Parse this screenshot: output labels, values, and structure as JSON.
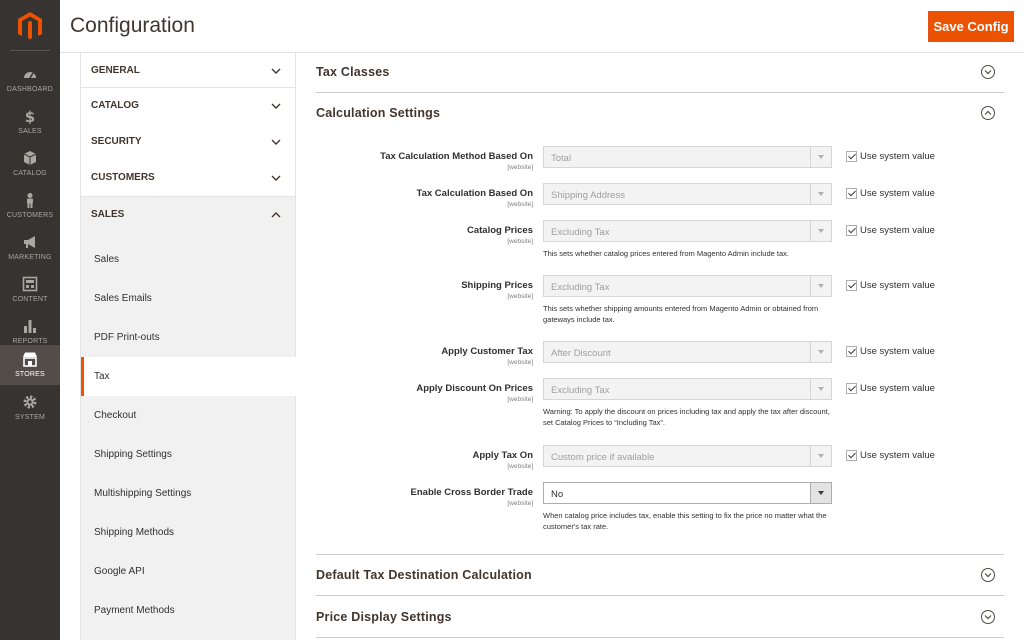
{
  "admin_nav": {
    "items": [
      {
        "label": "DASHBOARD",
        "icon": "dashboard-icon"
      },
      {
        "label": "SALES",
        "icon": "dollar-icon"
      },
      {
        "label": "CATALOG",
        "icon": "cube-icon"
      },
      {
        "label": "CUSTOMERS",
        "icon": "person-icon"
      },
      {
        "label": "MARKETING",
        "icon": "megaphone-icon"
      },
      {
        "label": "CONTENT",
        "icon": "layout-icon"
      },
      {
        "label": "REPORTS",
        "icon": "bar-chart-icon"
      },
      {
        "label": "STORES",
        "icon": "storefront-icon"
      },
      {
        "label": "SYSTEM",
        "icon": "gear-icon"
      }
    ],
    "active": "STORES"
  },
  "header": {
    "title": "Configuration",
    "save_label": "Save Config",
    "accent_color": "#eb5202"
  },
  "sidebar": {
    "tabs": [
      {
        "label": "GENERAL",
        "expanded": false
      },
      {
        "label": "CATALOG",
        "expanded": false
      },
      {
        "label": "SECURITY",
        "expanded": false
      },
      {
        "label": "CUSTOMERS",
        "expanded": false
      },
      {
        "label": "SALES",
        "expanded": true
      }
    ],
    "sales_items": [
      "Sales",
      "Sales Emails",
      "PDF Print-outs",
      "Tax",
      "Checkout",
      "Shipping Settings",
      "Multishipping Settings",
      "Shipping Methods",
      "Google API",
      "Payment Methods"
    ],
    "active_item": "Tax"
  },
  "main": {
    "sections": {
      "tax_classes": "Tax Classes",
      "calculation_settings": "Calculation Settings",
      "default_destination": "Default Tax Destination Calculation",
      "price_display": "Price Display Settings"
    },
    "system_value_label": "Use system value",
    "fields": [
      {
        "label": "Tax Calculation Method Based On",
        "scope": "[website]",
        "value": "Total",
        "use_system": true,
        "note": ""
      },
      {
        "label": "Tax Calculation Based On",
        "scope": "[website]",
        "value": "Shipping Address",
        "use_system": true,
        "note": ""
      },
      {
        "label": "Catalog Prices",
        "scope": "[website]",
        "value": "Excluding Tax",
        "use_system": true,
        "note": "This sets whether catalog prices entered from Magento Admin include tax."
      },
      {
        "label": "Shipping Prices",
        "scope": "[website]",
        "value": "Excluding Tax",
        "use_system": true,
        "note": "This sets whether shipping amounts entered from Magento Admin or obtained from gateways include tax."
      },
      {
        "label": "Apply Customer Tax",
        "scope": "[website]",
        "value": "After Discount",
        "use_system": true,
        "note": ""
      },
      {
        "label": "Apply Discount On Prices",
        "scope": "[website]",
        "value": "Excluding Tax",
        "use_system": true,
        "note": "Warning: To apply the discount on prices including tax and apply the tax after discount, set Catalog Prices to “Including Tax”."
      },
      {
        "label": "Apply Tax On",
        "scope": "[website]",
        "value": "Custom price if available",
        "use_system": true,
        "note": ""
      },
      {
        "label": "Enable Cross Border Trade",
        "scope": "[website]",
        "value": "No",
        "use_system": false,
        "note": "When catalog price includes tax, enable this setting to fix the price no matter what the customer's tax rate."
      }
    ]
  }
}
